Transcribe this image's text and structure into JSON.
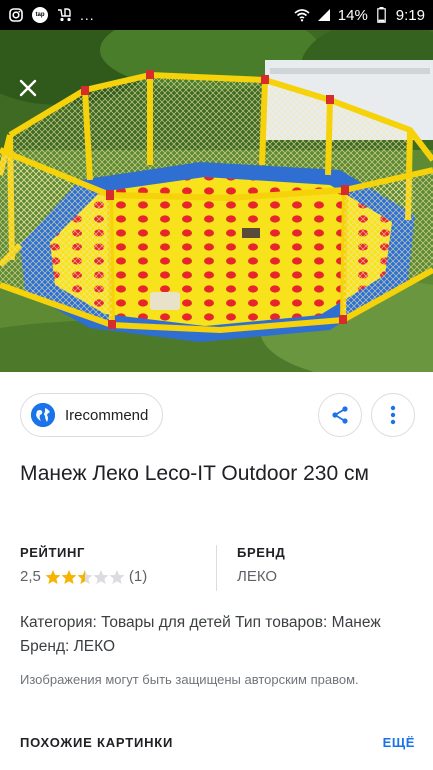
{
  "status_bar": {
    "app_badge": "tap",
    "more": "...",
    "battery": "14%",
    "time": "9:19"
  },
  "image": {
    "alt": "",
    "close_icon": "close-icon"
  },
  "source": {
    "name": "Irecommend",
    "icon": "globe-icon",
    "share_icon": "share-icon",
    "more_icon": "more-vert-icon"
  },
  "title": "Манеж Леко Leco-IT Outdoor 230 см",
  "rating": {
    "label": "РЕЙТИНГ",
    "value": "2,5",
    "stars": 2.5,
    "max": 5,
    "count": "(1)"
  },
  "brand": {
    "label": "БРЕНД",
    "value": "ЛЕКО"
  },
  "description": "Категория: Товары для детей Тип товаров: Манеж Бренд: ЛЕКО",
  "copyright": "Изображения могут быть защищены авторским правом.",
  "similar": {
    "title": "ПОХОЖИЕ КАРТИНКИ",
    "more": "ЕЩЁ"
  },
  "colors": {
    "accent": "#1a73e8",
    "star_filled": "#f4b400",
    "star_empty": "#dadce0"
  }
}
